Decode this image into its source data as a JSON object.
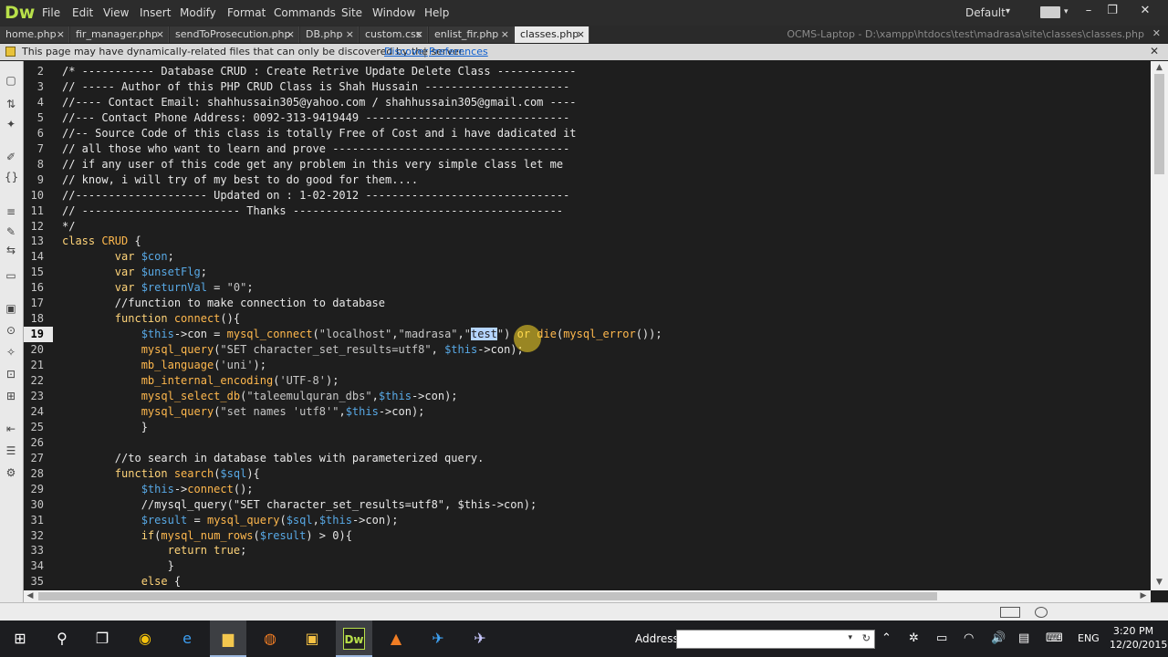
{
  "app": {
    "logo": "Dw",
    "menu": [
      "File",
      "Edit",
      "View",
      "Insert",
      "Modify",
      "Format",
      "Commands",
      "Site",
      "Window",
      "Help"
    ],
    "workspace": "Default",
    "window_buttons": [
      "–",
      "❐",
      "✕"
    ]
  },
  "tabs": [
    {
      "label": "home.php",
      "active": false
    },
    {
      "label": "fir_manager.php",
      "active": false
    },
    {
      "label": "sendToProsecution.php",
      "active": false
    },
    {
      "label": "DB.php",
      "active": false
    },
    {
      "label": "custom.css",
      "active": false
    },
    {
      "label": "enlist_fir.php",
      "active": false
    },
    {
      "label": "classes.php",
      "active": true
    }
  ],
  "tab_close": "×",
  "file_path": "OCMS-Laptop - D:\\xampp\\htdocs\\test\\madrasa\\site\\classes\\classes.php",
  "info_bar": {
    "text": "This page may have dynamically-related files that can only be discovered by the server.",
    "discover": "Discover",
    "separator": "|",
    "preferences": "Preferences",
    "close": "✕"
  },
  "editor": {
    "current_line": 19,
    "selected_text": "test",
    "lines": [
      {
        "n": 2,
        "segs": [
          [
            "c",
            "/* ----------- Database CRUD : Create Retrive Update Delete Class ------------"
          ]
        ]
      },
      {
        "n": 3,
        "segs": [
          [
            "c",
            "// ----- Author of this PHP CRUD Class is Shah Hussain ----------------------"
          ]
        ]
      },
      {
        "n": 4,
        "segs": [
          [
            "c",
            "//---- Contact Email: shahhussain305@yahoo.com / shahhussain305@gmail.com ----"
          ]
        ]
      },
      {
        "n": 5,
        "segs": [
          [
            "c",
            "//--- Contact Phone Address: 0092-313-9419449 -------------------------------"
          ]
        ]
      },
      {
        "n": 6,
        "segs": [
          [
            "c",
            "//-- Source Code of this class is totally Free of Cost and i have dadicated it"
          ]
        ]
      },
      {
        "n": 7,
        "segs": [
          [
            "c",
            "// all those who want to learn and prove ------------------------------------"
          ]
        ]
      },
      {
        "n": 8,
        "segs": [
          [
            "c",
            "// if any user of this code get any problem in this very simple class let me"
          ]
        ]
      },
      {
        "n": 9,
        "segs": [
          [
            "c",
            "// know, i will try of my best to do good for them...."
          ]
        ]
      },
      {
        "n": 10,
        "segs": [
          [
            "c",
            "//-------------------- Updated on : 1-02-2012 -------------------------------"
          ]
        ]
      },
      {
        "n": 11,
        "segs": [
          [
            "c",
            "// ------------------------ Thanks -----------------------------------------"
          ]
        ]
      },
      {
        "n": 12,
        "segs": [
          [
            "c",
            "*/"
          ]
        ]
      },
      {
        "n": 13,
        "segs": [
          [
            "k",
            "class "
          ],
          [
            "f",
            "CRUD"
          ],
          [
            "p",
            " {"
          ]
        ]
      },
      {
        "n": 14,
        "segs": [
          [
            "p",
            "        "
          ],
          [
            "k",
            "var "
          ],
          [
            "v",
            "$con"
          ],
          [
            "p",
            ";"
          ]
        ]
      },
      {
        "n": 15,
        "segs": [
          [
            "p",
            "        "
          ],
          [
            "k",
            "var "
          ],
          [
            "v",
            "$unsetFlg"
          ],
          [
            "p",
            ";"
          ]
        ]
      },
      {
        "n": 16,
        "segs": [
          [
            "p",
            "        "
          ],
          [
            "k",
            "var "
          ],
          [
            "v",
            "$returnVal"
          ],
          [
            "p",
            " = "
          ],
          [
            "s",
            "\"0\""
          ],
          [
            "p",
            ";"
          ]
        ]
      },
      {
        "n": 17,
        "segs": [
          [
            "p",
            "        "
          ],
          [
            "c",
            "//function to make connection to database"
          ]
        ]
      },
      {
        "n": 18,
        "segs": [
          [
            "p",
            "        "
          ],
          [
            "k",
            "function "
          ],
          [
            "f",
            "connect"
          ],
          [
            "p",
            "(){"
          ]
        ]
      },
      {
        "n": 19,
        "segs": [
          [
            "p",
            "            "
          ],
          [
            "v",
            "$this"
          ],
          [
            "p",
            "->con = "
          ],
          [
            "f",
            "mysql_connect"
          ],
          [
            "p",
            "("
          ],
          [
            "s",
            "\"localhost\""
          ],
          [
            "p",
            ","
          ],
          [
            "s",
            "\"madrasa\""
          ],
          [
            "p",
            ","
          ],
          [
            "s",
            "\""
          ],
          [
            "sel",
            "test"
          ],
          [
            "s",
            "\""
          ],
          [
            "p",
            ") "
          ],
          [
            "k",
            "or "
          ],
          [
            "f",
            "die"
          ],
          [
            "p",
            "("
          ],
          [
            "f",
            "mysql_error"
          ],
          [
            "p",
            "());"
          ]
        ]
      },
      {
        "n": 20,
        "segs": [
          [
            "p",
            "            "
          ],
          [
            "f",
            "mysql_query"
          ],
          [
            "p",
            "("
          ],
          [
            "s",
            "\"SET character_set_results=utf8\""
          ],
          [
            "p",
            ", "
          ],
          [
            "v",
            "$this"
          ],
          [
            "p",
            "->con);"
          ]
        ]
      },
      {
        "n": 21,
        "segs": [
          [
            "p",
            "            "
          ],
          [
            "f",
            "mb_language"
          ],
          [
            "p",
            "("
          ],
          [
            "s",
            "'uni'"
          ],
          [
            "p",
            ");"
          ]
        ]
      },
      {
        "n": 22,
        "segs": [
          [
            "p",
            "            "
          ],
          [
            "f",
            "mb_internal_encoding"
          ],
          [
            "p",
            "("
          ],
          [
            "s",
            "'UTF-8'"
          ],
          [
            "p",
            ");"
          ]
        ]
      },
      {
        "n": 23,
        "segs": [
          [
            "p",
            "            "
          ],
          [
            "f",
            "mysql_select_db"
          ],
          [
            "p",
            "("
          ],
          [
            "s",
            "\"taleemulquran_dbs\""
          ],
          [
            "p",
            ","
          ],
          [
            "v",
            "$this"
          ],
          [
            "p",
            "->con);"
          ]
        ]
      },
      {
        "n": 24,
        "segs": [
          [
            "p",
            "            "
          ],
          [
            "f",
            "mysql_query"
          ],
          [
            "p",
            "("
          ],
          [
            "s",
            "\"set names 'utf8'\""
          ],
          [
            "p",
            ","
          ],
          [
            "v",
            "$this"
          ],
          [
            "p",
            "->con);"
          ]
        ]
      },
      {
        "n": 25,
        "segs": [
          [
            "p",
            "            }"
          ]
        ]
      },
      {
        "n": 26,
        "segs": [
          [
            "p",
            ""
          ]
        ]
      },
      {
        "n": 27,
        "segs": [
          [
            "p",
            "        "
          ],
          [
            "c",
            "//to search in database tables with parameterized query."
          ]
        ]
      },
      {
        "n": 28,
        "segs": [
          [
            "p",
            "        "
          ],
          [
            "k",
            "function "
          ],
          [
            "f",
            "search"
          ],
          [
            "p",
            "("
          ],
          [
            "v",
            "$sql"
          ],
          [
            "p",
            "){"
          ]
        ]
      },
      {
        "n": 29,
        "segs": [
          [
            "p",
            "            "
          ],
          [
            "v",
            "$this"
          ],
          [
            "p",
            "->"
          ],
          [
            "f",
            "connect"
          ],
          [
            "p",
            "();"
          ]
        ]
      },
      {
        "n": 30,
        "segs": [
          [
            "p",
            "            "
          ],
          [
            "c",
            "//mysql_query(\"SET character_set_results=utf8\", $this->con);"
          ]
        ]
      },
      {
        "n": 31,
        "segs": [
          [
            "p",
            "            "
          ],
          [
            "v",
            "$result"
          ],
          [
            "p",
            " = "
          ],
          [
            "f",
            "mysql_query"
          ],
          [
            "p",
            "("
          ],
          [
            "v",
            "$sql"
          ],
          [
            "p",
            ","
          ],
          [
            "v",
            "$this"
          ],
          [
            "p",
            "->con);"
          ]
        ]
      },
      {
        "n": 32,
        "segs": [
          [
            "p",
            "            "
          ],
          [
            "k",
            "if"
          ],
          [
            "p",
            "("
          ],
          [
            "f",
            "mysql_num_rows"
          ],
          [
            "p",
            "("
          ],
          [
            "v",
            "$result"
          ],
          [
            "p",
            ") > 0){"
          ]
        ]
      },
      {
        "n": 33,
        "segs": [
          [
            "p",
            "                "
          ],
          [
            "k",
            "return true"
          ],
          [
            "p",
            ";"
          ]
        ]
      },
      {
        "n": 34,
        "segs": [
          [
            "p",
            "                }"
          ]
        ]
      },
      {
        "n": 35,
        "segs": [
          [
            "p",
            "            "
          ],
          [
            "k",
            "else"
          ],
          [
            "p",
            " {"
          ]
        ]
      }
    ]
  },
  "colors": {
    "c": "#e8e8e8",
    "k": "#ffd479",
    "f": "#ffb84d",
    "v": "#58a9e6",
    "s": "#c7c7c7",
    "p": "#e6e6e6",
    "sel_bg": "#b5d5ff",
    "sel_fg": "#202020"
  },
  "taskbar": {
    "address_label": "Address",
    "address_value": "",
    "lang": "ENG",
    "time": "3:20 PM",
    "date": "12/20/2015"
  }
}
